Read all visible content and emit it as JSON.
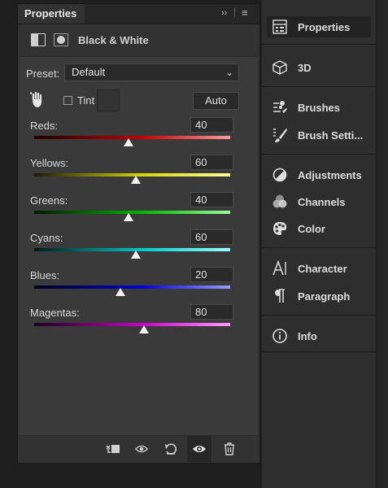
{
  "panel": {
    "tab_title": "Properties",
    "adjustment_title": "Black & White",
    "preset": {
      "label": "Preset:",
      "value": "Default"
    },
    "tint_label": "Tint",
    "auto_label": "Auto",
    "sliders": [
      {
        "label": "Reds:",
        "value": "40",
        "gradient": [
          "#1a0000",
          "#c40000",
          "#ff9a9a"
        ]
      },
      {
        "label": "Yellows:",
        "value": "60",
        "gradient": [
          "#1a1a00",
          "#d6d600",
          "#ffff9a"
        ]
      },
      {
        "label": "Greens:",
        "value": "40",
        "gradient": [
          "#001a00",
          "#00b400",
          "#9aff9a"
        ]
      },
      {
        "label": "Cyans:",
        "value": "60",
        "gradient": [
          "#001a1a",
          "#00c8c8",
          "#9affff"
        ]
      },
      {
        "label": "Blues:",
        "value": "20",
        "gradient": [
          "#00001a",
          "#0000d8",
          "#9a9aff"
        ]
      },
      {
        "label": "Magentas:",
        "value": "80",
        "gradient": [
          "#1a001a",
          "#c800c8",
          "#ff9aff"
        ]
      }
    ],
    "slider_range": [
      -200,
      300
    ]
  },
  "right_panel": {
    "items": [
      {
        "label": "Properties",
        "icon": "properties-icon",
        "active": true
      },
      {
        "label": "3D",
        "icon": "cube-icon"
      },
      {
        "label": "Brushes",
        "icon": "brushes-icon"
      },
      {
        "label": "Brush Setti...",
        "icon": "brush-settings-icon"
      },
      {
        "label": "Adjustments",
        "icon": "adjustments-icon"
      },
      {
        "label": "Channels",
        "icon": "channels-icon"
      },
      {
        "label": "Color",
        "icon": "palette-icon"
      },
      {
        "label": "Character",
        "icon": "character-icon"
      },
      {
        "label": "Paragraph",
        "icon": "paragraph-icon"
      },
      {
        "label": "Info",
        "icon": "info-icon"
      }
    ]
  },
  "colors": {
    "panel_bg": "#3a3a3a",
    "active_bg": "#232323"
  }
}
